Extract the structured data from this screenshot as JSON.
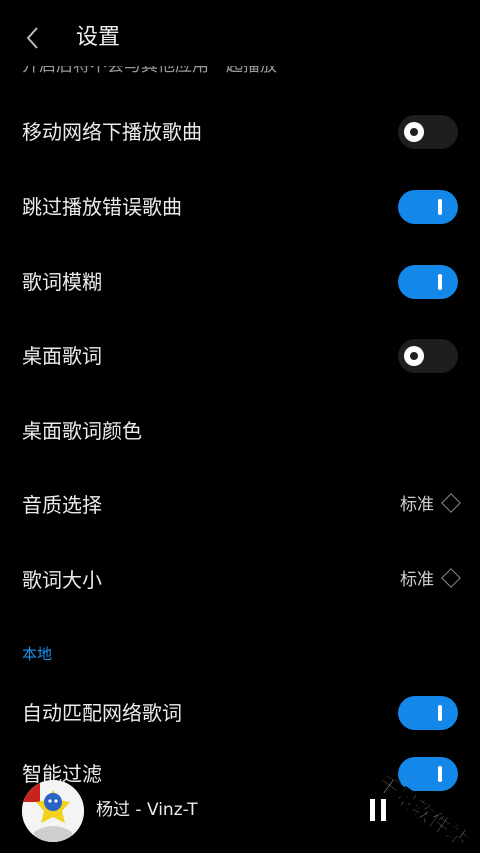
{
  "header": {
    "title": "设置"
  },
  "clipped_text": "开启后将不会与其他应用一起播放",
  "settings": [
    {
      "label": "移动网络下播放歌曲",
      "toggle": "off"
    },
    {
      "label": "跳过播放错误歌曲",
      "toggle": "on"
    },
    {
      "label": "歌词模糊",
      "toggle": "on"
    },
    {
      "label": "桌面歌词",
      "toggle": "off"
    },
    {
      "label": "桌面歌词颜色"
    },
    {
      "label": "音质选择",
      "value": "标准"
    },
    {
      "label": "歌词大小",
      "value": "标准"
    }
  ],
  "section_local": {
    "title": "本地"
  },
  "local_settings": [
    {
      "label": "自动匹配网络歌词",
      "toggle": "on"
    },
    {
      "label": "智能过滤",
      "toggle": "on"
    }
  ],
  "player": {
    "track": "杨过 - Vinz-T"
  },
  "watermark": "千景软件站",
  "colors": {
    "accent": "#1388e8",
    "section": "#1c8fe8",
    "background": "#000000",
    "toggle_off": "#1e1e1e"
  }
}
